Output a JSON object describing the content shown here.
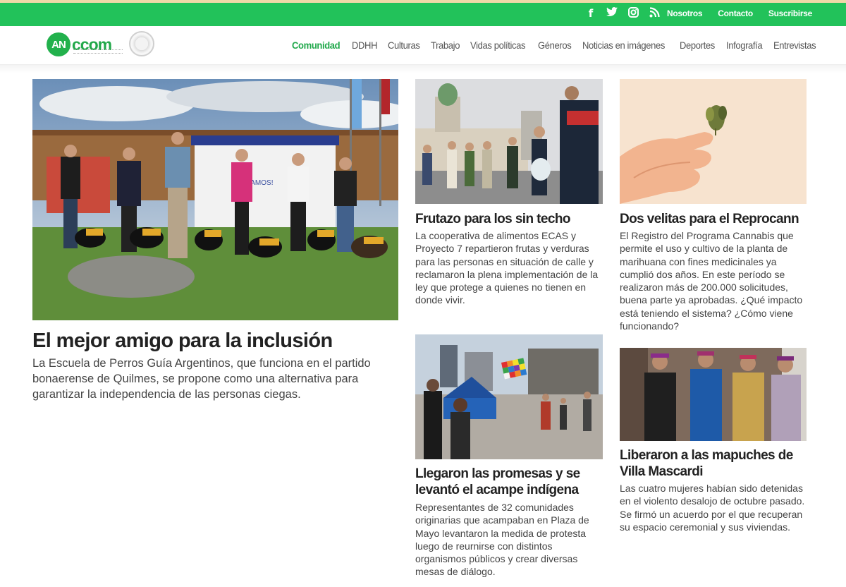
{
  "topbar": {
    "social_icons": [
      "facebook-icon",
      "twitter-icon",
      "instagram-icon",
      "rss-icon"
    ],
    "links": [
      "Nosotros",
      "Contacto",
      "Suscribirse"
    ],
    "accent": "#22c25a"
  },
  "header": {
    "logo_mark": "AN",
    "logo_text": "ccom",
    "nav": [
      "Comunidad",
      "DDHH",
      "Culturas",
      "Trabajo",
      "Vidas políticas",
      "Géneros",
      "Noticias en imágenes",
      "Deportes",
      "Infografía",
      "Entrevistas"
    ],
    "active_nav": "Comunidad"
  },
  "articles": {
    "main": {
      "title": "El mejor amigo para la inclusión",
      "summary": "La Escuela de Perros Guía Argentinos, que funciona en el partido bonaerense de Quilmes, se propone como una alternativa para garantizar la independencia de las personas ciegas.",
      "banner": "¡VAMOS!"
    },
    "frutazo": {
      "title": "Frutazo para los sin techo",
      "summary": "La cooperativa de alimentos ECAS y Proyecto 7 repartieron frutas y verduras para las personas en situación de calle y reclamaron la plena implementación de la ley que protege a quienes no tienen en donde vivir."
    },
    "reprocann": {
      "title": "Dos velitas para el Reprocann",
      "summary": "El Registro del Programa Cannabis que permite el uso y cultivo de la planta de marihuana con fines medicinales ya cumplió dos años. En este período se realizaron más de 200.000 solicitudes, buena parte ya aprobadas. ¿Qué impacto está teniendo el sistema? ¿Cómo viene funcionando?"
    },
    "acampe": {
      "title": "Llegaron las promesas y se levantó el acampe indígena",
      "summary": "Representantes de 32 comunidades originarias que acampaban en Plaza de Mayo levantaron la medida de protesta luego de reurnirse con distintos organismos públicos y crear diversas mesas de diálogo."
    },
    "mapuches": {
      "title": "Liberaron a las mapuches de Villa Mascardi",
      "summary": "Las cuatro mujeres habían sido detenidas en el violento desalojo de octubre pasado. Se firmó un acuerdo por el que recuperan su espacio ceremonial y sus viviendas."
    }
  }
}
